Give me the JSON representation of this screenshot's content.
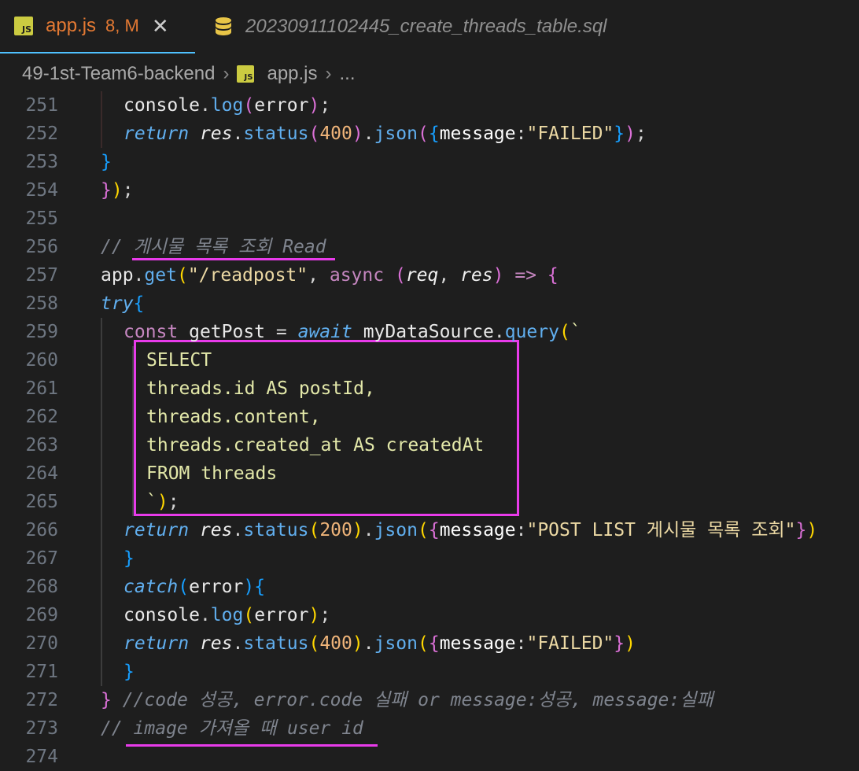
{
  "tabs": [
    {
      "icon": "js-file-icon",
      "badge": "JS",
      "title": "app.js",
      "status": "8, M",
      "active": true
    },
    {
      "icon": "database-icon",
      "title": "20230911102445_create_threads_table.sql",
      "active": false
    }
  ],
  "breadcrumb": {
    "folder": "49-1st-Team6-backend",
    "file_badge": "JS",
    "file": "app.js",
    "tail": "..."
  },
  "colors": {
    "annotation": "#e83bea",
    "modified": "#e37933",
    "active_tab_border": "#4fc1ff"
  },
  "lines": [
    {
      "n": "251",
      "tokens": [
        {
          "t": "console",
          "c": "c-id"
        },
        {
          "t": ".",
          "c": "c-sep"
        },
        {
          "t": "log",
          "c": "k-fn"
        },
        {
          "t": "(",
          "c": "br-pink"
        },
        {
          "t": "error",
          "c": "c-id"
        },
        {
          "t": ")",
          "c": "br-pink"
        },
        {
          "t": ";",
          "c": "c-sep"
        }
      ],
      "indent": 1
    },
    {
      "n": "252",
      "tokens": [
        {
          "t": "return",
          "c": "k-fn k-ital"
        },
        {
          "t": " ",
          "c": "c-id"
        },
        {
          "t": "res",
          "c": "c-white k-ital"
        },
        {
          "t": ".",
          "c": "c-sep"
        },
        {
          "t": "status",
          "c": "k-fn"
        },
        {
          "t": "(",
          "c": "br-pink"
        },
        {
          "t": "400",
          "c": "c-num"
        },
        {
          "t": ")",
          "c": "br-pink"
        },
        {
          "t": ".",
          "c": "c-sep"
        },
        {
          "t": "json",
          "c": "k-fn"
        },
        {
          "t": "(",
          "c": "br-pink"
        },
        {
          "t": "{",
          "c": "br-blue"
        },
        {
          "t": "message",
          "c": "c-key"
        },
        {
          "t": ":",
          "c": "c-sep"
        },
        {
          "t": "\"FAILED\"",
          "c": "c-str"
        },
        {
          "t": "}",
          "c": "br-blue"
        },
        {
          "t": ")",
          "c": "br-pink"
        },
        {
          "t": ";",
          "c": "c-sep"
        }
      ],
      "indent": 1
    },
    {
      "n": "253",
      "tokens": [
        {
          "t": "}",
          "c": "br-blue"
        }
      ],
      "indent": 0
    },
    {
      "n": "254",
      "tokens": [
        {
          "t": "}",
          "c": "br-pink"
        },
        {
          "t": ")",
          "c": "br-yellow"
        },
        {
          "t": ";",
          "c": "c-sep"
        }
      ],
      "indent": 0
    },
    {
      "n": "255",
      "tokens": [],
      "indent": 0
    },
    {
      "n": "256",
      "tokens": [
        {
          "t": "// 게시물 목록 조회 Read",
          "c": "c-comment"
        }
      ],
      "indent": 0
    },
    {
      "n": "257",
      "tokens": [
        {
          "t": "app",
          "c": "c-id"
        },
        {
          "t": ".",
          "c": "c-sep"
        },
        {
          "t": "get",
          "c": "k-fn"
        },
        {
          "t": "(",
          "c": "br-yellow"
        },
        {
          "t": "\"/readpost\"",
          "c": "c-str"
        },
        {
          "t": ", ",
          "c": "c-sep"
        },
        {
          "t": "async",
          "c": "k-purple"
        },
        {
          "t": " ",
          "c": "c-id"
        },
        {
          "t": "(",
          "c": "br-pink"
        },
        {
          "t": "req",
          "c": "c-white k-ital"
        },
        {
          "t": ", ",
          "c": "c-sep"
        },
        {
          "t": "res",
          "c": "c-white k-ital"
        },
        {
          "t": ")",
          "c": "br-pink"
        },
        {
          "t": " ",
          "c": "c-id"
        },
        {
          "t": "=>",
          "c": "k-purple"
        },
        {
          "t": " ",
          "c": "c-id"
        },
        {
          "t": "{",
          "c": "br-pink"
        }
      ],
      "indent": 0
    },
    {
      "n": "258",
      "tokens": [
        {
          "t": "try",
          "c": "k-fn k-ital"
        },
        {
          "t": "{",
          "c": "br-blue"
        }
      ],
      "indent": 0
    },
    {
      "n": "259",
      "tokens": [
        {
          "t": "const",
          "c": "k-purple"
        },
        {
          "t": " getPost ",
          "c": "c-id"
        },
        {
          "t": "=",
          "c": "c-sep"
        },
        {
          "t": " ",
          "c": "c-id"
        },
        {
          "t": "await",
          "c": "k-fn k-ital"
        },
        {
          "t": " myDataSource",
          "c": "c-id"
        },
        {
          "t": ".",
          "c": "c-sep"
        },
        {
          "t": "query",
          "c": "k-fn"
        },
        {
          "t": "(",
          "c": "br-yellow"
        },
        {
          "t": "`",
          "c": "c-tmpl"
        }
      ],
      "indent": 1
    },
    {
      "n": "260",
      "tokens": [
        {
          "t": "SELECT",
          "c": "c-tmpl"
        }
      ],
      "indent": 2
    },
    {
      "n": "261",
      "tokens": [
        {
          "t": "threads.id AS postId,",
          "c": "c-tmpl"
        }
      ],
      "indent": 2
    },
    {
      "n": "262",
      "tokens": [
        {
          "t": "threads.content,",
          "c": "c-tmpl"
        }
      ],
      "indent": 2
    },
    {
      "n": "263",
      "tokens": [
        {
          "t": "threads.created_at AS createdAt",
          "c": "c-tmpl"
        }
      ],
      "indent": 2
    },
    {
      "n": "264",
      "tokens": [
        {
          "t": "FROM threads",
          "c": "c-tmpl"
        }
      ],
      "indent": 2
    },
    {
      "n": "265",
      "tokens": [
        {
          "t": "`",
          "c": "c-tmpl"
        },
        {
          "t": ")",
          "c": "br-yellow"
        },
        {
          "t": ";",
          "c": "c-sep"
        }
      ],
      "indent": 2
    },
    {
      "n": "266",
      "tokens": [
        {
          "t": "return",
          "c": "k-fn k-ital"
        },
        {
          "t": " ",
          "c": "c-id"
        },
        {
          "t": "res",
          "c": "c-white k-ital"
        },
        {
          "t": ".",
          "c": "c-sep"
        },
        {
          "t": "status",
          "c": "k-fn"
        },
        {
          "t": "(",
          "c": "br-yellow"
        },
        {
          "t": "200",
          "c": "c-num"
        },
        {
          "t": ")",
          "c": "br-yellow"
        },
        {
          "t": ".",
          "c": "c-sep"
        },
        {
          "t": "json",
          "c": "k-fn"
        },
        {
          "t": "(",
          "c": "br-yellow"
        },
        {
          "t": "{",
          "c": "br-pink"
        },
        {
          "t": "message",
          "c": "c-key"
        },
        {
          "t": ":",
          "c": "c-sep"
        },
        {
          "t": "\"POST LIST 게시물 목록 조회\"",
          "c": "c-str"
        },
        {
          "t": "}",
          "c": "br-pink"
        },
        {
          "t": ")",
          "c": "br-yellow"
        }
      ],
      "indent": 1
    },
    {
      "n": "267",
      "tokens": [
        {
          "t": "}",
          "c": "br-blue"
        }
      ],
      "indent": 1
    },
    {
      "n": "268",
      "tokens": [
        {
          "t": "catch",
          "c": "k-fn k-ital"
        },
        {
          "t": "(",
          "c": "br-blue"
        },
        {
          "t": "error",
          "c": "c-id"
        },
        {
          "t": ")",
          "c": "br-blue"
        },
        {
          "t": "{",
          "c": "br-blue"
        }
      ],
      "indent": 1
    },
    {
      "n": "269",
      "tokens": [
        {
          "t": "console",
          "c": "c-id"
        },
        {
          "t": ".",
          "c": "c-sep"
        },
        {
          "t": "log",
          "c": "k-fn"
        },
        {
          "t": "(",
          "c": "br-yellow"
        },
        {
          "t": "error",
          "c": "c-id"
        },
        {
          "t": ")",
          "c": "br-yellow"
        },
        {
          "t": ";",
          "c": "c-sep"
        }
      ],
      "indent": 1
    },
    {
      "n": "270",
      "tokens": [
        {
          "t": "return",
          "c": "k-fn k-ital"
        },
        {
          "t": " ",
          "c": "c-id"
        },
        {
          "t": "res",
          "c": "c-white k-ital"
        },
        {
          "t": ".",
          "c": "c-sep"
        },
        {
          "t": "status",
          "c": "k-fn"
        },
        {
          "t": "(",
          "c": "br-yellow"
        },
        {
          "t": "400",
          "c": "c-num"
        },
        {
          "t": ")",
          "c": "br-yellow"
        },
        {
          "t": ".",
          "c": "c-sep"
        },
        {
          "t": "json",
          "c": "k-fn"
        },
        {
          "t": "(",
          "c": "br-yellow"
        },
        {
          "t": "{",
          "c": "br-pink"
        },
        {
          "t": "message",
          "c": "c-key"
        },
        {
          "t": ":",
          "c": "c-sep"
        },
        {
          "t": "\"FAILED\"",
          "c": "c-str"
        },
        {
          "t": "}",
          "c": "br-pink"
        },
        {
          "t": ")",
          "c": "br-yellow"
        }
      ],
      "indent": 1
    },
    {
      "n": "271",
      "tokens": [
        {
          "t": "}",
          "c": "br-blue"
        }
      ],
      "indent": 1
    },
    {
      "n": "272",
      "tokens": [
        {
          "t": "}",
          "c": "br-pink"
        },
        {
          "t": " //code 성공, error.code 실패 or message:성공, message:실패",
          "c": "c-comment"
        }
      ],
      "indent": 0
    },
    {
      "n": "273",
      "tokens": [
        {
          "t": "// image 가져올 때 user id",
          "c": "c-comment"
        }
      ],
      "indent": 0
    },
    {
      "n": "274",
      "tokens": [],
      "indent": 0
    }
  ]
}
